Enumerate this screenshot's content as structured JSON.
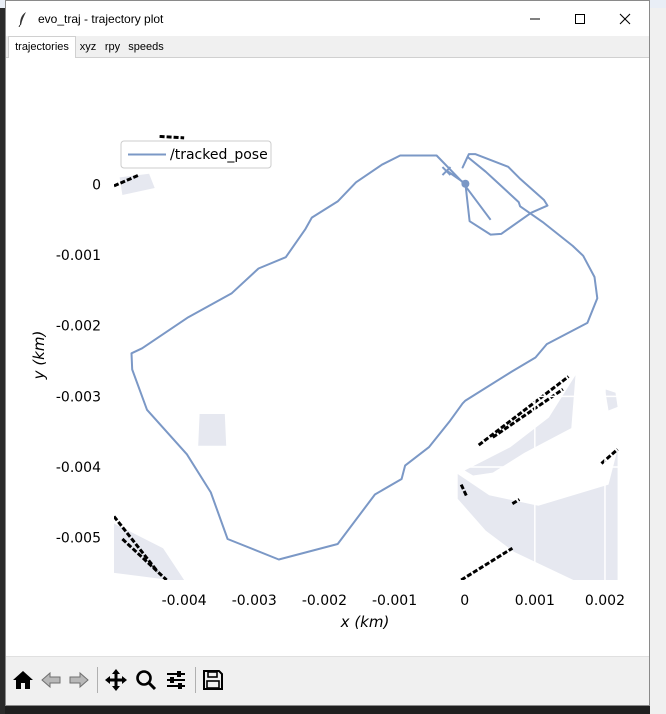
{
  "window": {
    "title": "evo_traj - trajectory plot"
  },
  "tabs": [
    {
      "label": "trajectories",
      "active": true
    },
    {
      "label": "xyz",
      "active": false
    },
    {
      "label": "rpy",
      "active": false
    },
    {
      "label": "speeds",
      "active": false
    }
  ],
  "toolbar": {
    "buttons": [
      "home-icon",
      "back-icon",
      "forward-icon",
      "pan-icon",
      "zoom-icon",
      "configure-subplots-icon",
      "save-icon"
    ]
  },
  "colors": {
    "trajectory": "#7b98c6",
    "map_occupied": "#000000",
    "map_free": "#e6e8f0",
    "grid": "#ffffff"
  },
  "chart_data": {
    "type": "line",
    "xlabel": "x (km)",
    "ylabel": "y (km)",
    "xlim": [
      -0.005,
      0.0022
    ],
    "ylim": [
      -0.0056,
      0.0007
    ],
    "xticks": [
      -0.004,
      -0.003,
      -0.002,
      -0.001,
      0,
      0.001,
      0.002
    ],
    "xtick_labels": [
      "-0.004",
      "-0.003",
      "-0.002",
      "-0.001",
      "0",
      "0.001",
      "0.002"
    ],
    "yticks": [
      0,
      -0.001,
      -0.002,
      -0.003,
      -0.004,
      -0.005
    ],
    "ytick_labels": [
      "0",
      "-0.001",
      "-0.002",
      "-0.003",
      "-0.004",
      "-0.005"
    ],
    "legend": {
      "placement": "top-left",
      "entries": [
        "/tracked_pose"
      ]
    },
    "series": [
      {
        "name": "/tracked_pose",
        "start": [
          1e-05,
          1e-05
        ],
        "end": [
          -0.00026,
          0.00019
        ],
        "x": [
          0.00037,
          -3e-05,
          -0.0004,
          -0.00092,
          -0.00118,
          -0.00155,
          -0.00181,
          -0.00218,
          -0.00227,
          -0.00255,
          -0.00294,
          -0.00332,
          -0.00394,
          -0.0046,
          -0.00475,
          -0.00474,
          -0.00453,
          -0.00396,
          -0.00362,
          -0.00338,
          -0.00265,
          -0.00181,
          -0.00128,
          -0.0009,
          -0.00085,
          -0.00051,
          -0.00022,
          -3e-05,
          1e-05,
          0.00067,
          0.00101,
          0.00117,
          0.00175,
          0.00189,
          0.00185,
          0.00169,
          0.00154,
          0.00111,
          0.00079,
          0.00077,
          0.00042,
          0.0003,
          4e-05,
          -3e-05,
          6e-05,
          0.00015,
          0.00062,
          0.00078,
          0.00113,
          0.00118,
          0.00095,
          0.00052,
          0.00037,
          7e-05,
          1e-05,
          -0.00025
        ],
        "y": [
          -0.0005,
          3e-05,
          0.00041,
          0.00041,
          0.00028,
          3e-05,
          -0.00024,
          -0.00047,
          -0.00063,
          -0.00103,
          -0.00119,
          -0.00154,
          -0.00188,
          -0.00232,
          -0.00239,
          -0.00262,
          -0.00319,
          -0.00382,
          -0.00436,
          -0.00502,
          -0.00531,
          -0.00509,
          -0.00439,
          -0.00417,
          -0.00398,
          -0.00372,
          -0.00336,
          -0.0031,
          -0.00306,
          -0.00265,
          -0.00245,
          -0.00226,
          -0.00196,
          -0.00161,
          -0.00131,
          -0.00101,
          -0.00087,
          -0.00053,
          -0.00031,
          -0.00025,
          7e-05,
          0.00018,
          0.00039,
          0.00024,
          0.00043,
          0.00043,
          0.00025,
          9e-05,
          -0.00022,
          -0.0003,
          -0.0004,
          -0.0007,
          -0.00071,
          -0.00052,
          1e-05,
          0.00019
        ]
      }
    ],
    "map_overlay": {
      "free_regions": [
        {
          "x": [
            -0.00492,
            -0.0045,
            -0.00442,
            -0.00488
          ],
          "y": [
            0.0001,
            0.00015,
            -5e-05,
            -0.00015
          ]
        },
        {
          "x": [
            -0.00378,
            -0.00342,
            -0.0034,
            -0.0038
          ],
          "y": [
            -0.00325,
            -0.00325,
            -0.0037,
            -0.0037
          ]
        },
        {
          "x": [
            0.0,
            0.00065,
            0.0012,
            0.00158,
            0.00152,
            0.00085,
            0.0004,
            0.00012
          ],
          "y": [
            -0.00405,
            -0.00372,
            -0.0033,
            -0.0027,
            -0.00345,
            -0.0038,
            -0.00408,
            -0.00412
          ]
        },
        {
          "x": [
            -0.0001,
            0.00035,
            0.00105,
            0.00205,
            0.00218,
            0.00218,
            0.00155,
            0.0007,
            0.0003,
            -0.0001
          ],
          "y": [
            -0.0041,
            -0.0044,
            -0.00455,
            -0.00425,
            -0.00375,
            -0.0056,
            -0.0056,
            -0.0052,
            -0.0049,
            -0.00445
          ]
        },
        {
          "x": [
            0.002,
            0.00215,
            0.00218,
            0.00205
          ],
          "y": [
            -0.0029,
            -0.00295,
            -0.00315,
            -0.0032
          ]
        },
        {
          "x": [
            -0.005,
            -0.0043,
            -0.004,
            -0.0042,
            -0.005
          ],
          "y": [
            -0.0048,
            -0.00515,
            -0.0056,
            -0.0056,
            -0.0055
          ]
        }
      ],
      "occupied_segments": [
        {
          "x": [
            -0.005,
            -0.00465
          ],
          "y": [
            -2e-05,
            0.00013
          ]
        },
        {
          "x": [
            -0.00435,
            -0.004
          ],
          "y": [
            0.00068,
            0.00066
          ]
        },
        {
          "x": [
            0.0002,
            0.00148
          ],
          "y": [
            -0.00369,
            -0.00272
          ]
        },
        {
          "x": [
            0.0004,
            0.0014
          ],
          "y": [
            -0.00358,
            -0.0029
          ]
        },
        {
          "x": [
            -0.005,
            -0.00438
          ],
          "y": [
            -0.0047,
            -0.00548
          ]
        },
        {
          "x": [
            -0.00488,
            -0.00425
          ],
          "y": [
            -0.00502,
            -0.0056
          ]
        },
        {
          "x": [
            -5e-05,
            0.00068
          ],
          "y": [
            -0.0056,
            -0.00515
          ]
        },
        {
          "x": [
            0.00195,
            0.00218
          ],
          "y": [
            -0.00395,
            -0.00375
          ]
        },
        {
          "x": [
            0.00068,
            0.00078
          ],
          "y": [
            -0.00452,
            -0.00446
          ]
        },
        {
          "x": [
            -5e-05,
            3e-05
          ],
          "y": [
            -0.00425,
            -0.00442
          ]
        }
      ],
      "grid_x": [
        0.001,
        0.002
      ],
      "grid_y": [
        -0.004,
        -0.003
      ]
    }
  }
}
